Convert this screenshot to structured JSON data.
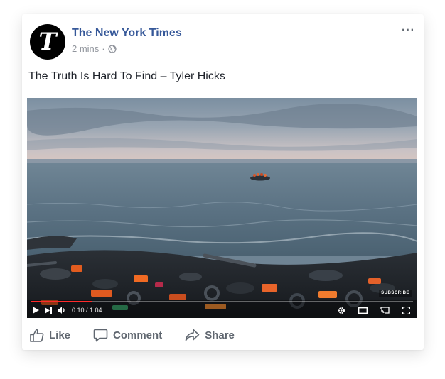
{
  "post": {
    "page_name": "The New York Times",
    "timestamp": "2 mins",
    "separator": "·",
    "avatar_letter": "T",
    "more_label": "···",
    "text": "The Truth Is Hard To Find – Tyler Hicks"
  },
  "video": {
    "time": "0:10 / 1:04",
    "progress": 0.16,
    "subscribe_label": "SUBSCRIBE"
  },
  "actions": {
    "like": "Like",
    "comment": "Comment",
    "share": "Share"
  },
  "colors": {
    "link": "#365899",
    "meta": "#90949c",
    "action": "#606770",
    "progress": "#ff2a2a"
  }
}
